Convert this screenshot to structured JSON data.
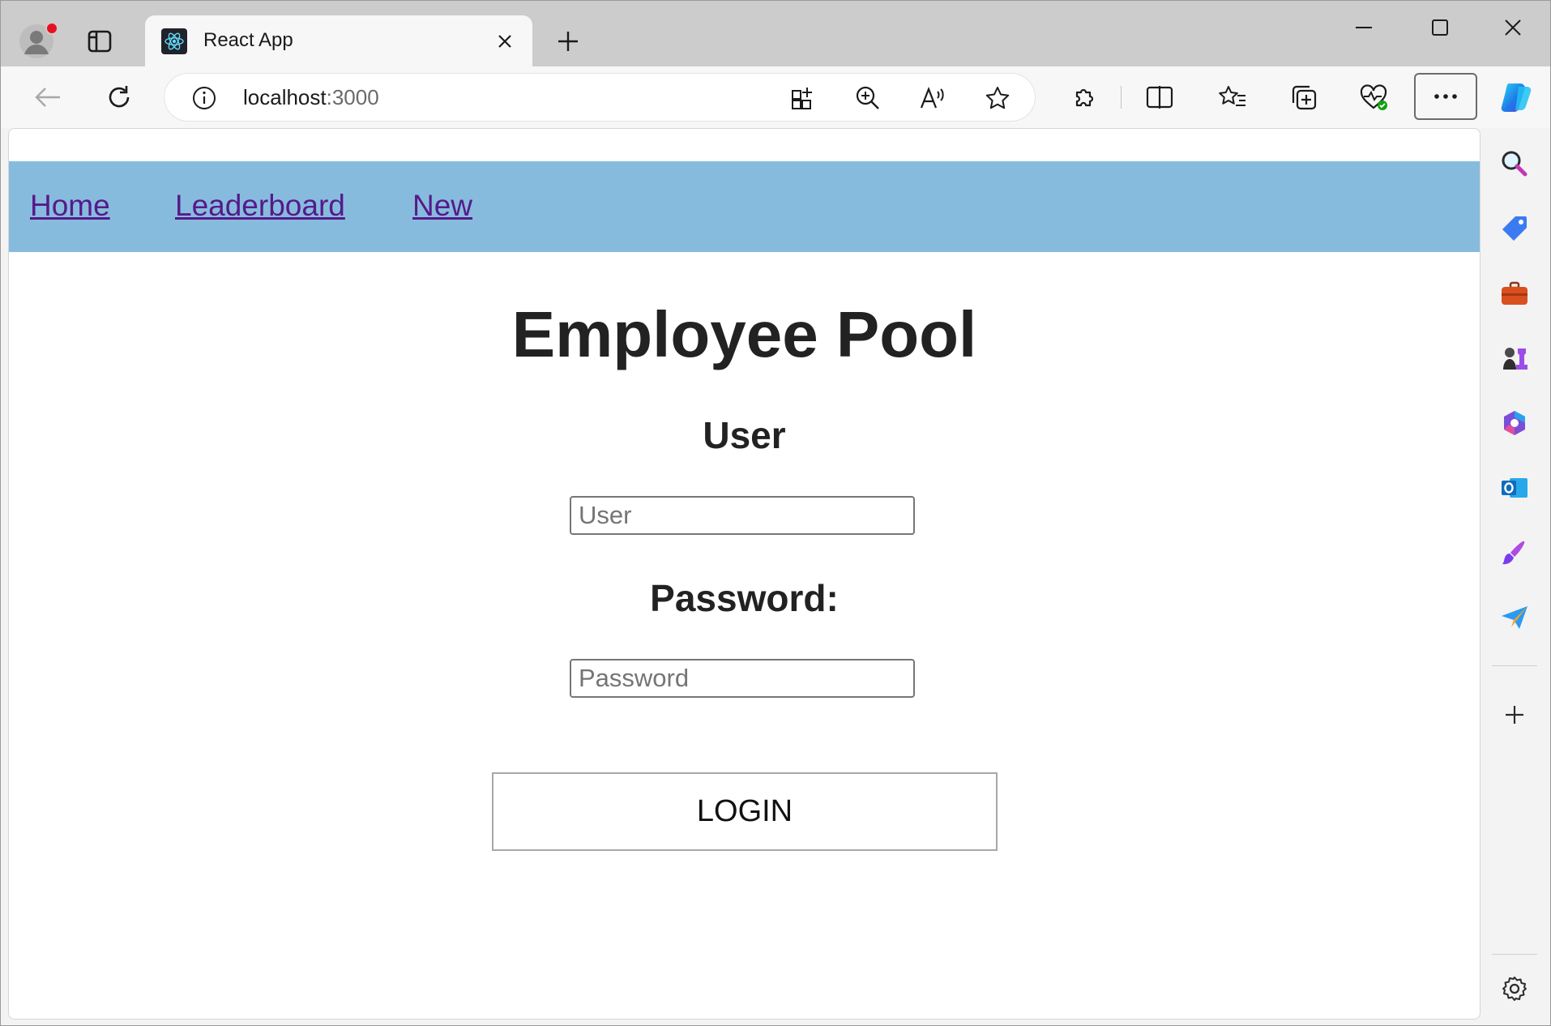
{
  "browser": {
    "tab": {
      "title": "React App",
      "favicon": "react-logo-icon"
    },
    "address": {
      "host": "localhost",
      "port": ":3000"
    },
    "toolbar_icons": [
      "back-arrow-icon",
      "refresh-icon",
      "site-info-icon",
      "app-available-icon",
      "zoom-icon",
      "read-aloud-icon",
      "favorite-star-icon",
      "extensions-icon",
      "split-screen-icon",
      "favorites-icon",
      "collections-icon",
      "browser-essentials-icon",
      "more-options-icon",
      "copilot-icon"
    ],
    "sidebar_icons": [
      "search-icon",
      "shopping-tag-icon",
      "tools-briefcase-icon",
      "games-icon",
      "microsoft-365-icon",
      "outlook-icon",
      "designer-icon",
      "drop-send-icon",
      "add-icon",
      "settings-gear-icon"
    ],
    "accent": "#87bbdd"
  },
  "nav": {
    "home": "Home",
    "leaderboard": "Leaderboard",
    "new": "New"
  },
  "page": {
    "title": "Employee Pool",
    "user_label": "User",
    "user_placeholder": "User",
    "password_label": "Password:",
    "password_placeholder": "Password",
    "login_label": "LOGIN"
  }
}
